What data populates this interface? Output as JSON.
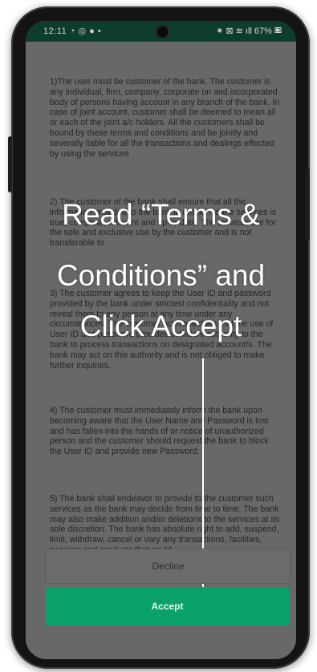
{
  "status_bar": {
    "time": "12:11",
    "left_icons": "◔ ◎ ● •",
    "right_icons": "⁕ ⊠ ≋ ıll",
    "battery": "67%"
  },
  "terms": [
    "1)The user must be customer of the bank. The customer is any individual, firm, company, corporate on and incorporated body of persons having account in any branch of the bank. In case of joint account, customer shall be deemed to mean all or each of the joint a/c holders. All the customers shall be bound by these terms and conditions and be jointly and severally liable for all the transactions and dealings effected by using the services",
    "2) The customer of the bank shall ensure that all the information provided to the bank in relation to the services is true, complete, relevant and up-to-date. The services are for the sole and exclusive use by the customer and is not transferable to",
    "3) The customer agrees to keep the User ID and password provided by the bank under strictest confidentiality and not reveal them to any person at any time under any circumstances. The customer acknowledges that the use of User ID and password provides sufficient authority to the bank to process transactions on designated account/s. The bank may act on this authority and is not obliged to make further inquiries.",
    "4) The customer must immediately inform the bank upon becoming aware that the User Name and Password is lost and has fallen into the hands of or notice of unauthorized person and the customer should request the bank to block the User ID and provide new Password.",
    "5) The bank shall endeavor to provide to the customer such services as the bank may decide from time to time. The bank may also make addition and/or deletions to the services at its sole discretion. The bank has absolute right to add, suspend, limit, withdraw, cancel or vary any transactions, facilities, services and products that could"
  ],
  "overlay": {
    "line1": "Read “Terms &",
    "line2": "Conditions” and",
    "line3": "Click Accept"
  },
  "buttons": {
    "decline": "Decline",
    "accept": "Accept"
  },
  "colors": {
    "accept_bg": "#0aa26b",
    "status_bar_bg": "#0f3d2c"
  }
}
